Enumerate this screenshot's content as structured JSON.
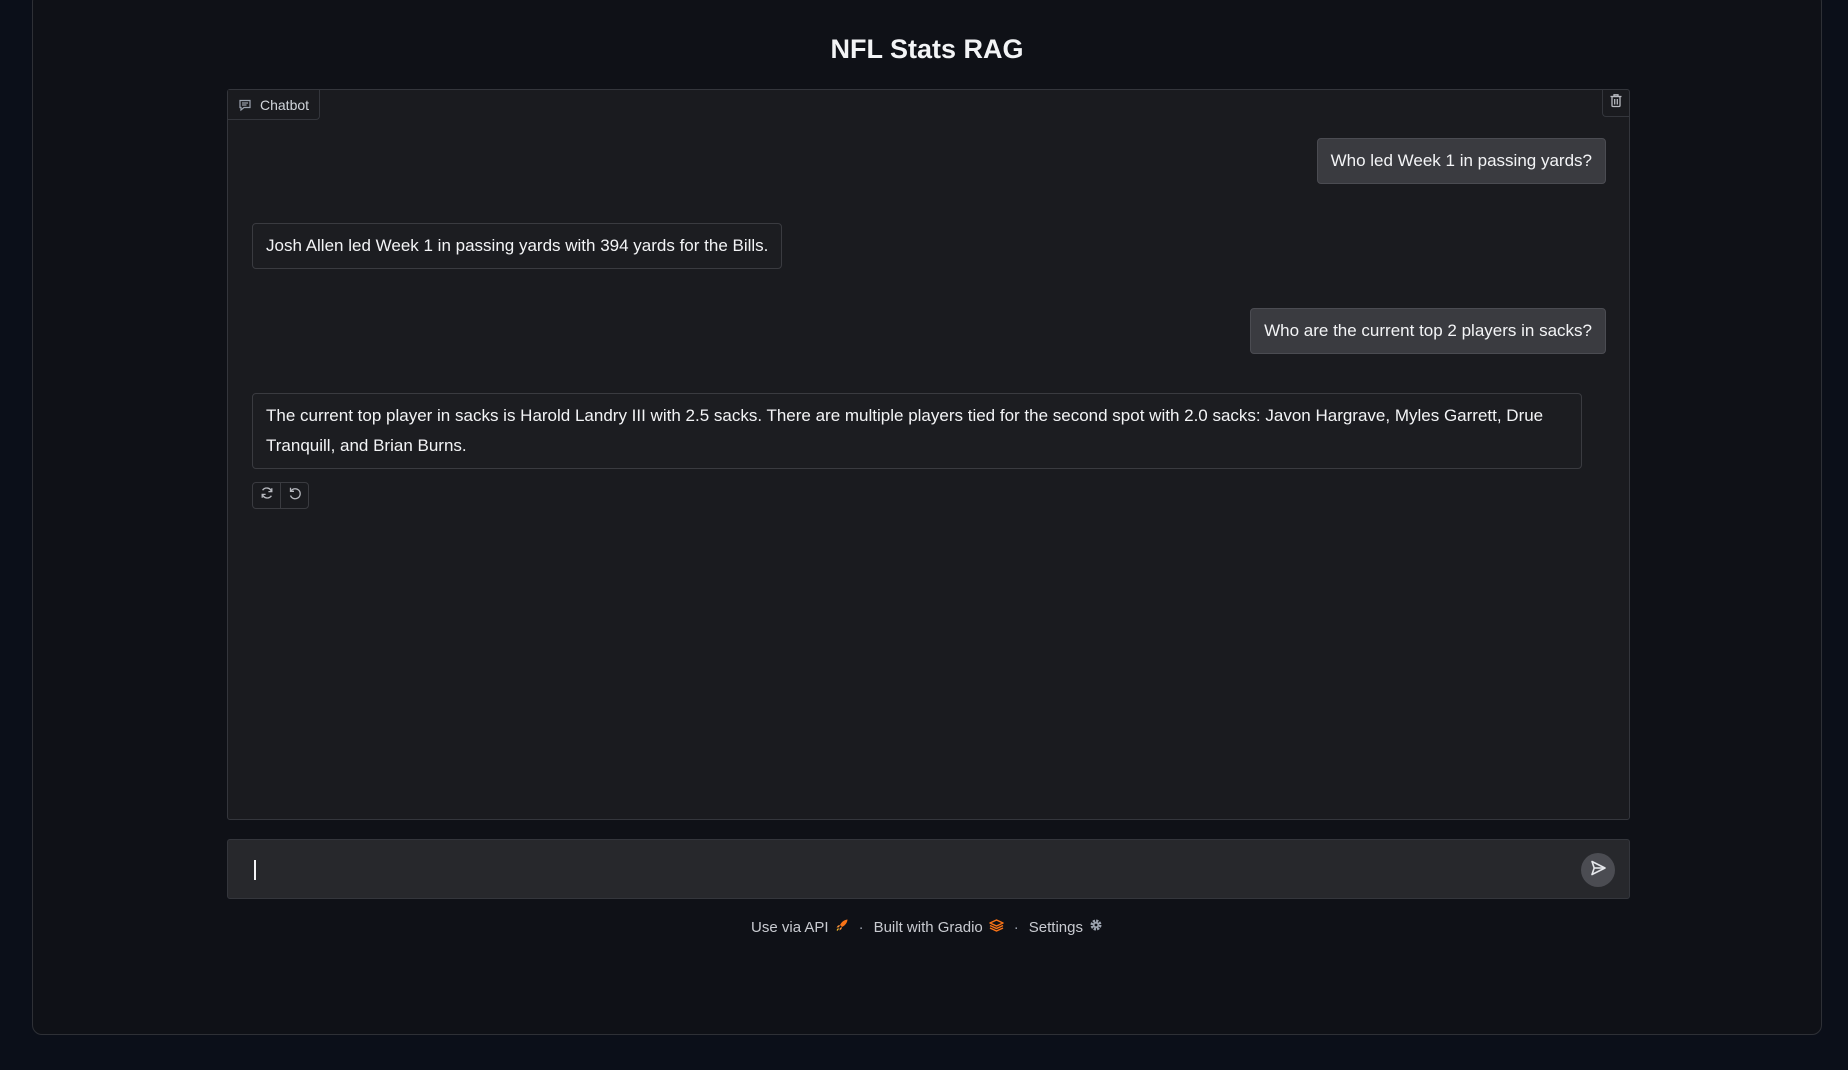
{
  "app": {
    "title": "NFL Stats RAG"
  },
  "chatbot": {
    "label": "Chatbot",
    "messages": [
      {
        "role": "user",
        "text": "Who led Week 1 in passing yards?"
      },
      {
        "role": "bot",
        "text": "Josh Allen led Week 1 in passing yards with 394 yards for the Bills."
      },
      {
        "role": "user",
        "text": "Who are the current top 2 players in sacks?"
      },
      {
        "role": "bot",
        "text": "The current top player in sacks is Harold Landry III with 2.5 sacks. There are multiple players tied for the second spot with 2.0 sacks: Javon Hargrave, Myles Garrett, Drue Tranquill, and Brian Burns."
      }
    ],
    "actions": {
      "retry_icon": "retry-icon",
      "undo_icon": "undo-icon"
    },
    "clear_icon": "trash-icon"
  },
  "input": {
    "value": "",
    "placeholder": ""
  },
  "footer": {
    "api_label": "Use via API",
    "built_label": "Built with Gradio",
    "settings_label": "Settings",
    "separator": "·"
  },
  "colors": {
    "background": "#0b0f19",
    "panel": "#1a1b1f",
    "user_bubble": "#3a3b40",
    "accent_orange": "#f97316"
  }
}
